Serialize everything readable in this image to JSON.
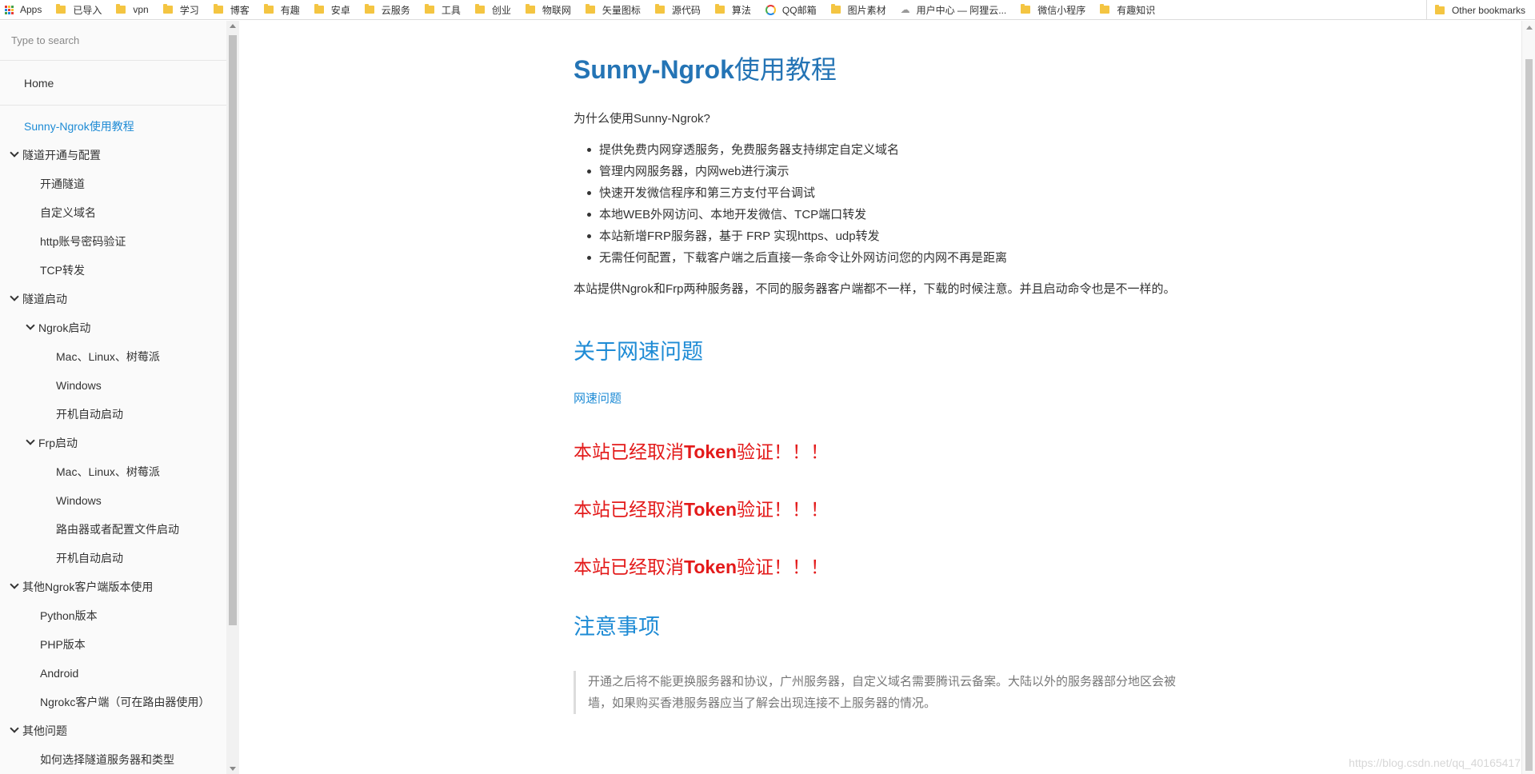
{
  "bookmarks": {
    "apps": "Apps",
    "items": [
      "已导入",
      "vpn",
      "学习",
      "博客",
      "有趣",
      "安卓",
      "云服务",
      "工具",
      "创业",
      "物联网",
      "矢量图标",
      "源代码",
      "算法",
      "QQ邮箱",
      "图片素材",
      "用户中心 — 阿狸云...",
      "微信小程序",
      "有趣知识"
    ],
    "other": "Other bookmarks"
  },
  "sidebar": {
    "search_placeholder": "Type to search",
    "home": "Home",
    "active": "Sunny-Ngrok使用教程",
    "tunnel_section": "隧道开通与配置",
    "tunnel_items": [
      "开通隧道",
      "自定义域名",
      "http账号密码验证",
      "TCP转发"
    ],
    "start_section": "隧道启动",
    "ngrok_start": "Ngrok启动",
    "ngrok_items": [
      "Mac、Linux、树莓派",
      "Windows",
      "开机自动启动"
    ],
    "frp_start": "Frp启动",
    "frp_items": [
      "Mac、Linux、树莓派",
      "Windows",
      "路由器或者配置文件启动",
      "开机自动启动"
    ],
    "other_clients": "其他Ngrok客户端版本使用",
    "client_items": [
      "Python版本",
      "PHP版本",
      "Android",
      "Ngrokc客户端（可在路由器使用）"
    ],
    "other_issues": "其他问题",
    "issue_items": [
      "如何选择隧道服务器和类型"
    ]
  },
  "main": {
    "title_en": "Sunny-Ngrok",
    "title_cn": "使用教程",
    "why": "为什么使用Sunny-Ngrok?",
    "features": [
      "提供免费内网穿透服务，免费服务器支持绑定自定义域名",
      "管理内网服务器，内网web进行演示",
      "快速开发微信程序和第三方支付平台调试",
      "本地WEB外网访问、本地开发微信、TCP端口转发",
      "本站新增FRP服务器，基于 FRP 实现https、udp转发",
      "无需任何配置，下载客户端之后直接一条命令让外网访问您的内网不再是距离"
    ],
    "intro": "本站提供Ngrok和Frp两种服务器，不同的服务器客户端都不一样，下载的时候注意。并且启动命令也是不一样的。",
    "speed_heading": "关于网速问题",
    "speed_link": "网速问题",
    "warning_pre": "本站已经取消",
    "warning_token": "Token",
    "warning_post": "验证！！！",
    "notes_heading": "注意事项",
    "notes": "开通之后将不能更换服务器和协议，广州服务器，自定义域名需要腾讯云备案。大陆以外的服务器部分地区会被墙，如果购买香港服务器应当了解会出现连接不上服务器的情况。"
  },
  "watermark": "https://blog.csdn.net/qq_40165417",
  "colors": {
    "link": "#1e8bd5",
    "title": "#2474b5",
    "warning": "#e31a1a"
  }
}
